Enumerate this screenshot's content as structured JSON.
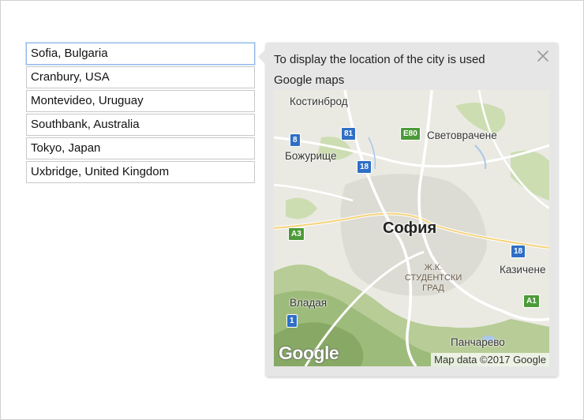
{
  "cities": [
    {
      "label": "Sofia, Bulgaria",
      "selected": true
    },
    {
      "label": "Cranbury, USA",
      "selected": false
    },
    {
      "label": "Montevideo, Uruguay",
      "selected": false
    },
    {
      "label": "Southbank, Australia",
      "selected": false
    },
    {
      "label": "Tokyo, Japan",
      "selected": false
    },
    {
      "label": "Uxbridge, United Kingdom",
      "selected": false
    }
  ],
  "popover": {
    "message": "To display the location of the city is used Google maps",
    "close_icon": "close-icon"
  },
  "map": {
    "city": "София",
    "places": {
      "kostinbrod": "Костинброд",
      "svetovrachene": "Световрачене",
      "bozhurishte": "Божурище",
      "vladaya": "Владая",
      "kazichene": "Казичене",
      "pancharevo": "Панчарево"
    },
    "district": "Ж.К. СТУДЕНТСКИ ГРАД",
    "shields": {
      "s81": "81",
      "e80": "E80",
      "s8": "8",
      "s18a": "18",
      "a3": "A3",
      "s18b": "18",
      "a1": "A1",
      "s1": "1"
    },
    "logo": "Google",
    "attribution": "Map data ©2017 Google"
  },
  "colors": {
    "selected_border": "#8fb7e6",
    "popover_bg": "#e6e6e6",
    "shield_blue": "#2f6fc5",
    "shield_green": "#4c9a39"
  }
}
